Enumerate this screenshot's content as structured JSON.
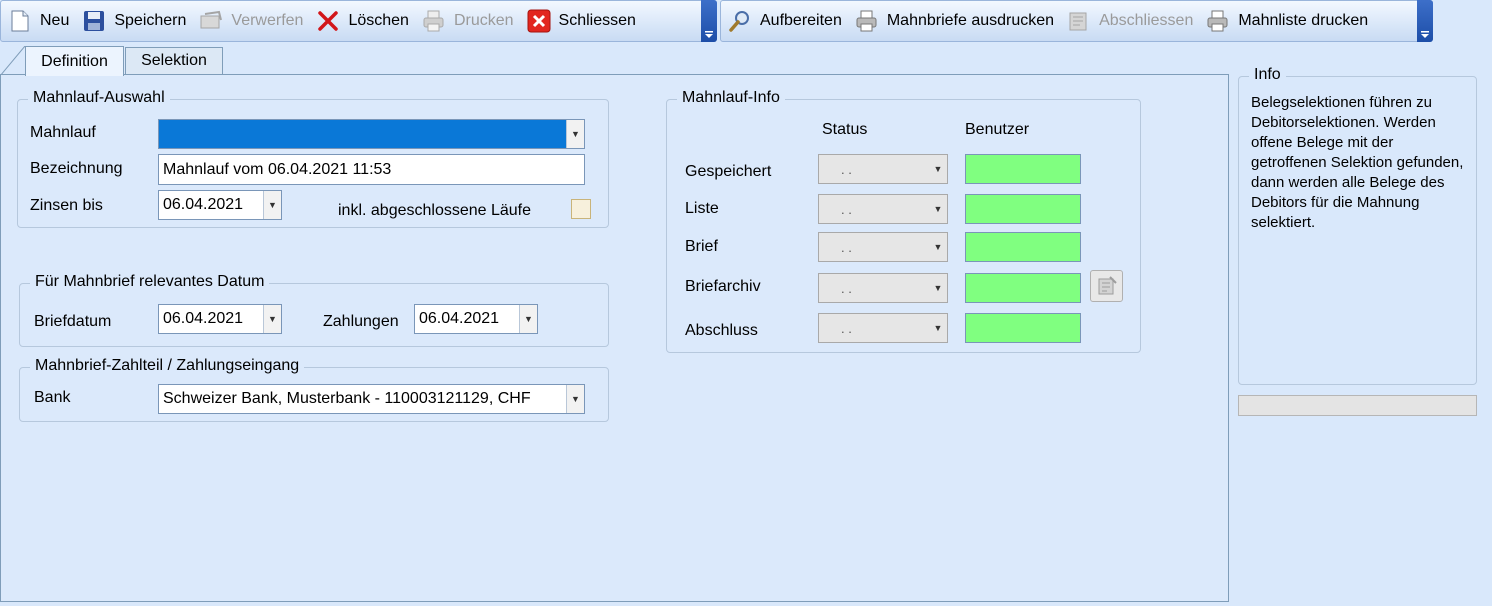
{
  "toolbar_main": {
    "items": [
      {
        "label": "Neu",
        "icon": "new-document-icon",
        "enabled": true
      },
      {
        "label": "Speichern",
        "icon": "save-disk-icon",
        "enabled": true
      },
      {
        "label": "Verwerfen",
        "icon": "discard-icon",
        "enabled": false
      },
      {
        "label": "Löschen",
        "icon": "delete-x-icon",
        "enabled": true
      },
      {
        "label": "Drucken",
        "icon": "printer-icon",
        "enabled": false
      },
      {
        "label": "Schliessen",
        "icon": "close-red-icon",
        "enabled": true
      }
    ]
  },
  "toolbar_actions": {
    "items": [
      {
        "label": "Aufbereiten",
        "icon": "magnifier-icon",
        "enabled": true
      },
      {
        "label": "Mahnbriefe ausdrucken",
        "icon": "printer-icon",
        "enabled": true
      },
      {
        "label": "Abschliessen",
        "icon": "archive-icon",
        "enabled": false
      },
      {
        "label": "Mahnliste drucken",
        "icon": "printer-icon",
        "enabled": true
      }
    ]
  },
  "tabs": [
    {
      "label": "Definition",
      "active": true
    },
    {
      "label": "Selektion",
      "active": false
    }
  ],
  "auswahl": {
    "title": "Mahnlauf-Auswahl",
    "mahnlauf_label": "Mahnlauf",
    "mahnlauf_value": "",
    "bezeichnung_label": "Bezeichnung",
    "bezeichnung_value": "Mahnlauf vom 06.04.2021 11:53",
    "zinsen_label": "Zinsen bis",
    "zinsen_value": "06.04.2021",
    "inkl_label": "inkl. abgeschlossene Läufe",
    "inkl_checked": false
  },
  "datum": {
    "title": "Für Mahnbrief relevantes Datum",
    "briefdatum_label": "Briefdatum",
    "briefdatum_value": "06.04.2021",
    "zahlungen_label": "Zahlungen",
    "zahlungen_value": "06.04.2021"
  },
  "zahlteil": {
    "title": "Mahnbrief-Zahlteil / Zahlungseingang",
    "bank_label": "Bank",
    "bank_value": "Schweizer Bank, Musterbank - 110003121129, CHF"
  },
  "info_panel": {
    "title": "Mahnlauf-Info",
    "col_status": "Status",
    "col_benutzer": "Benutzer",
    "rows": [
      {
        "label": "Gespeichert",
        "status": " .  . "
      },
      {
        "label": "Liste",
        "status": " .  . "
      },
      {
        "label": "Brief",
        "status": " .  . "
      },
      {
        "label": "Briefarchiv",
        "status": " .  . "
      },
      {
        "label": "Abschluss",
        "status": " .  . "
      }
    ]
  },
  "info_side": {
    "title": "Info",
    "text": "Belegselektionen führen zu Debitorselektionen. Werden offene Belege mit der getroffenen Selektion gefunden, dann werden alle Belege des Debitors für die Mahnung selektiert."
  },
  "colors": {
    "accent": "#0a78d7",
    "green": "#80ff80",
    "background": "#dbe9fb"
  }
}
